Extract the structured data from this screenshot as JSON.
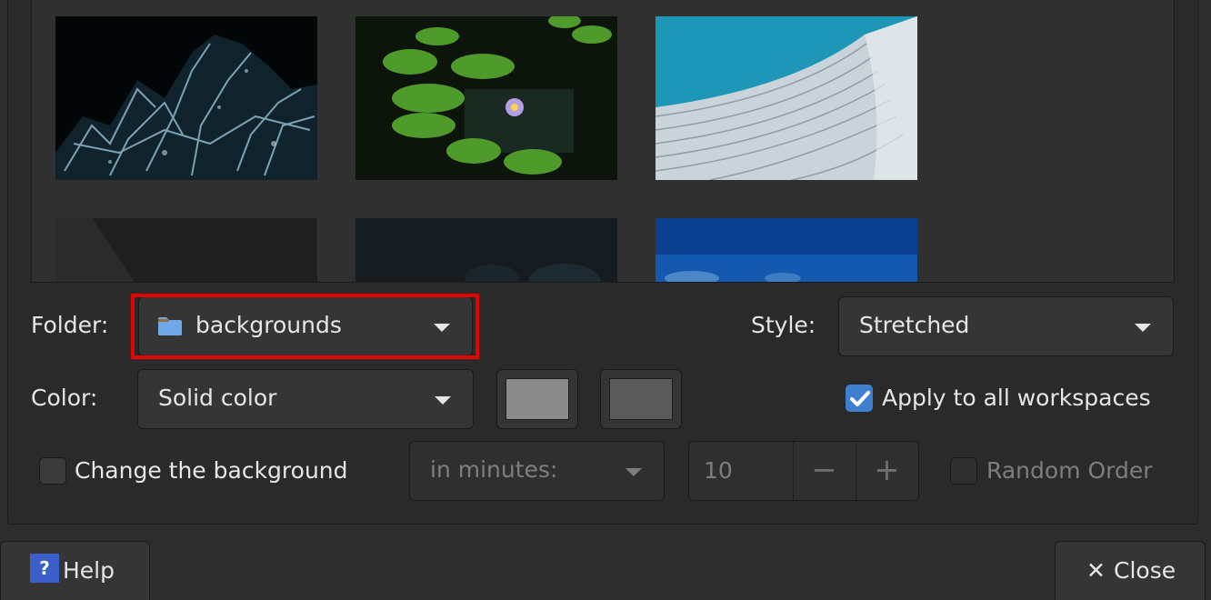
{
  "wallpapers": [
    {
      "name": "dark-water-splash-thumbnail"
    },
    {
      "name": "lily-pads-thumbnail"
    },
    {
      "name": "blue-sky-mesh-building-thumbnail"
    },
    {
      "name": "dark-gray-diagonal-thumbnail"
    },
    {
      "name": "dark-grid-thumbnail"
    },
    {
      "name": "blue-water-thumbnail"
    }
  ],
  "folder": {
    "label": "Folder:",
    "value": "backgrounds",
    "icon": "folder-icon",
    "icon_color": "#6fa8e8"
  },
  "style": {
    "label": "Style:",
    "value": "Stretched"
  },
  "color": {
    "label": "Color:",
    "value": "Solid color",
    "primary": "#8a8a8a",
    "secondary": "#5a5a5a"
  },
  "apply_all": {
    "label": "Apply to all workspaces",
    "checked": true
  },
  "change_background": {
    "label": "Change the background",
    "checked": false
  },
  "interval": {
    "value": "in minutes:",
    "enabled": false
  },
  "minutes": {
    "value": "10",
    "decrement": "−",
    "increment": "+"
  },
  "random_order": {
    "label": "Random Order",
    "checked": false
  },
  "buttons": {
    "help": "Help",
    "help_icon": "?",
    "close": "Close",
    "close_icon": "✕"
  },
  "accent": "#3f7fd0",
  "highlight_color": "#e60000"
}
